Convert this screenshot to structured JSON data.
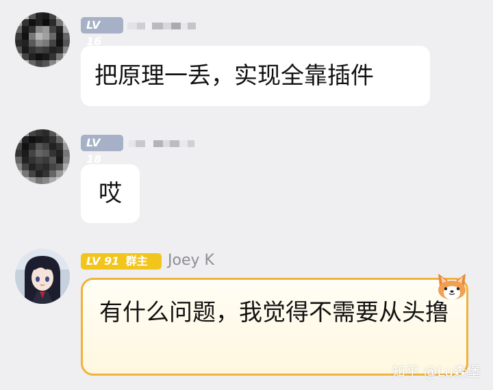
{
  "messages": [
    {
      "level": "LV 16",
      "text": "把原理一丢，实现全靠插件"
    },
    {
      "level": "LV 18",
      "text": "哎"
    }
  ],
  "owner_message": {
    "level": "LV 91",
    "role": "群主",
    "name": "Joey K",
    "text": "有什么问题，我觉得不需要从头撸"
  },
  "watermark": "知乎 @Lu森堡",
  "colors": {
    "background": "#efeff1",
    "level_badge_grey": "#a6b0c6",
    "level_badge_gold": "#f2c51c",
    "owner_bubble_border": "#f0b23a"
  },
  "icons": {
    "corgi_decoration": "corgi-icon"
  }
}
